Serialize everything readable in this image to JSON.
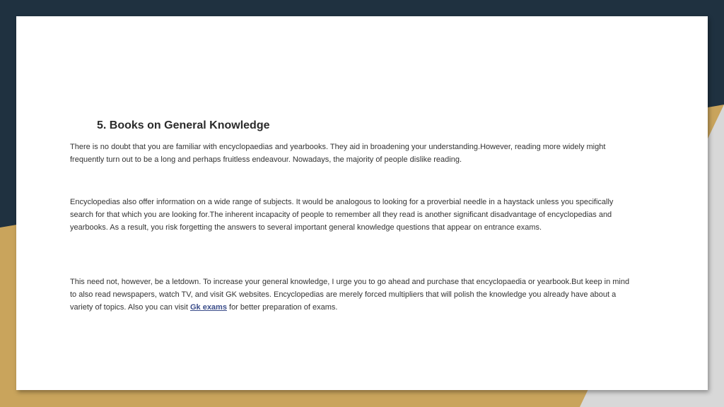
{
  "colors": {
    "background_dark": "#1f3140",
    "background_gold": "#c9a45c",
    "slide": "#ffffff",
    "text": "#333333",
    "link": "#3b4d8a"
  },
  "section": {
    "heading": "5. Books on General Knowledge",
    "paragraph1": "There is no doubt that you are familiar with encyclopaedias and yearbooks. They aid in broadening your understanding.However, reading more widely might frequently turn out to be a long and perhaps fruitless endeavour. Nowadays, the majority of people dislike reading.",
    "paragraph2": "Encyclopedias also offer information on a wide range of subjects. It would be analogous to looking for a proverbial needle in a haystack unless you specifically search for that which you are looking for.The inherent incapacity of people to remember all they read is another significant disadvantage of encyclopedias and yearbooks. As a result, you risk forgetting the answers to several important general knowledge questions that appear on entrance exams.",
    "paragraph3_before_link": "This need not, however, be a letdown. To increase your general knowledge, I urge you to go ahead and purchase that encyclopaedia or yearbook.But keep in mind to also read newspapers, watch TV, and visit GK websites. Encyclopedias are merely forced multipliers that will polish the knowledge you already have about a variety of topics. Also you can visit ",
    "link_text": "Gk exams",
    "paragraph3_after_link": " for better preparation of exams."
  }
}
